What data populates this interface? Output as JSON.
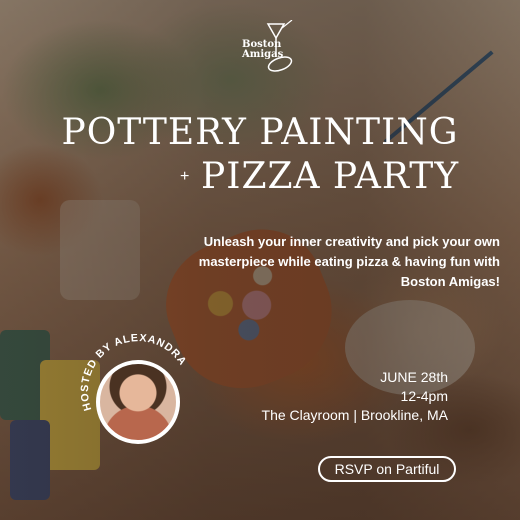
{
  "logo": {
    "line1": "Boston",
    "line2": "Amigas",
    "icon": "cocktail-glass-icon"
  },
  "title": {
    "line1": "POTTERY PAINTING",
    "plus": "+",
    "line2": "PIZZA PARTY"
  },
  "description": "Unleash your inner creativity and pick your own masterpiece while eating pizza & having fun with Boston Amigas!",
  "host": {
    "label": "HOSTED BY ALEXANDRA"
  },
  "event": {
    "date": "JUNE 28th",
    "time": "12-4pm",
    "location": "The Clayroom | Brookline, MA"
  },
  "rsvp": {
    "label": "RSVP on Partiful"
  }
}
